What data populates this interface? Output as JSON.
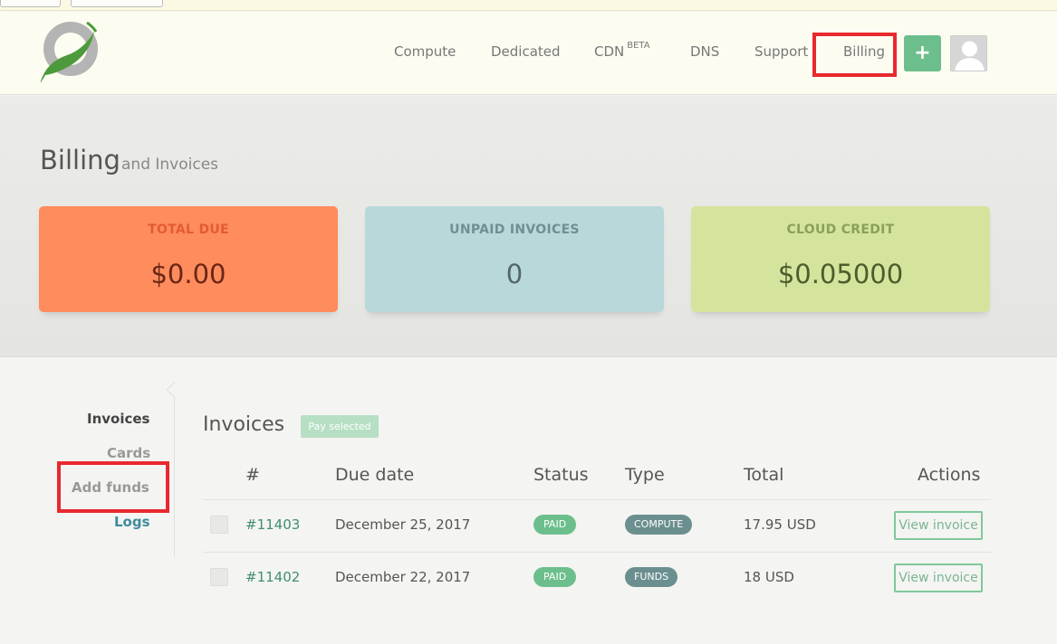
{
  "nav": {
    "compute": "Compute",
    "dedicated": "Dedicated",
    "cdn": "CDN",
    "cdn_badge": "BETA",
    "dns": "DNS",
    "support": "Support",
    "billing": "Billing",
    "add_label": "+"
  },
  "page": {
    "title": "Billing",
    "subtitle": "and Invoices"
  },
  "cards": {
    "total_due": {
      "label": "TOTAL DUE",
      "value": "$0.00",
      "bg": "#ff8c5c",
      "label_color": "#e35a37",
      "value_color": "#6a2616"
    },
    "unpaid": {
      "label": "UNPAID INVOICES",
      "value": "0",
      "bg": "#b9d8d9",
      "label_color": "#6f8f93",
      "value_color": "#53676a"
    },
    "credit": {
      "label": "CLOUD CREDIT",
      "value": "$0.05000",
      "bg": "#d5e49d",
      "label_color": "#8aa05c",
      "value_color": "#4c5c2b"
    }
  },
  "sidebar": {
    "items": [
      {
        "label": "Invoices",
        "color": "#444"
      },
      {
        "label": "Cards",
        "color": "#999"
      },
      {
        "label": "Add funds",
        "color": "#999"
      },
      {
        "label": "Logs",
        "color": "#3e8c9a"
      }
    ]
  },
  "invoices": {
    "title": "Invoices",
    "pay_selected": "Pay selected",
    "columns": [
      "#",
      "Due date",
      "Status",
      "Type",
      "Total",
      "Actions"
    ],
    "rows": [
      {
        "id": "#11403",
        "due": "December 25, 2017",
        "status": "PAID",
        "type": "COMPUTE",
        "total": "17.95 USD",
        "action": "View invoice"
      },
      {
        "id": "#11402",
        "due": "December 22, 2017",
        "status": "PAID",
        "type": "FUNDS",
        "total": "18 USD",
        "action": "View invoice"
      }
    ]
  }
}
